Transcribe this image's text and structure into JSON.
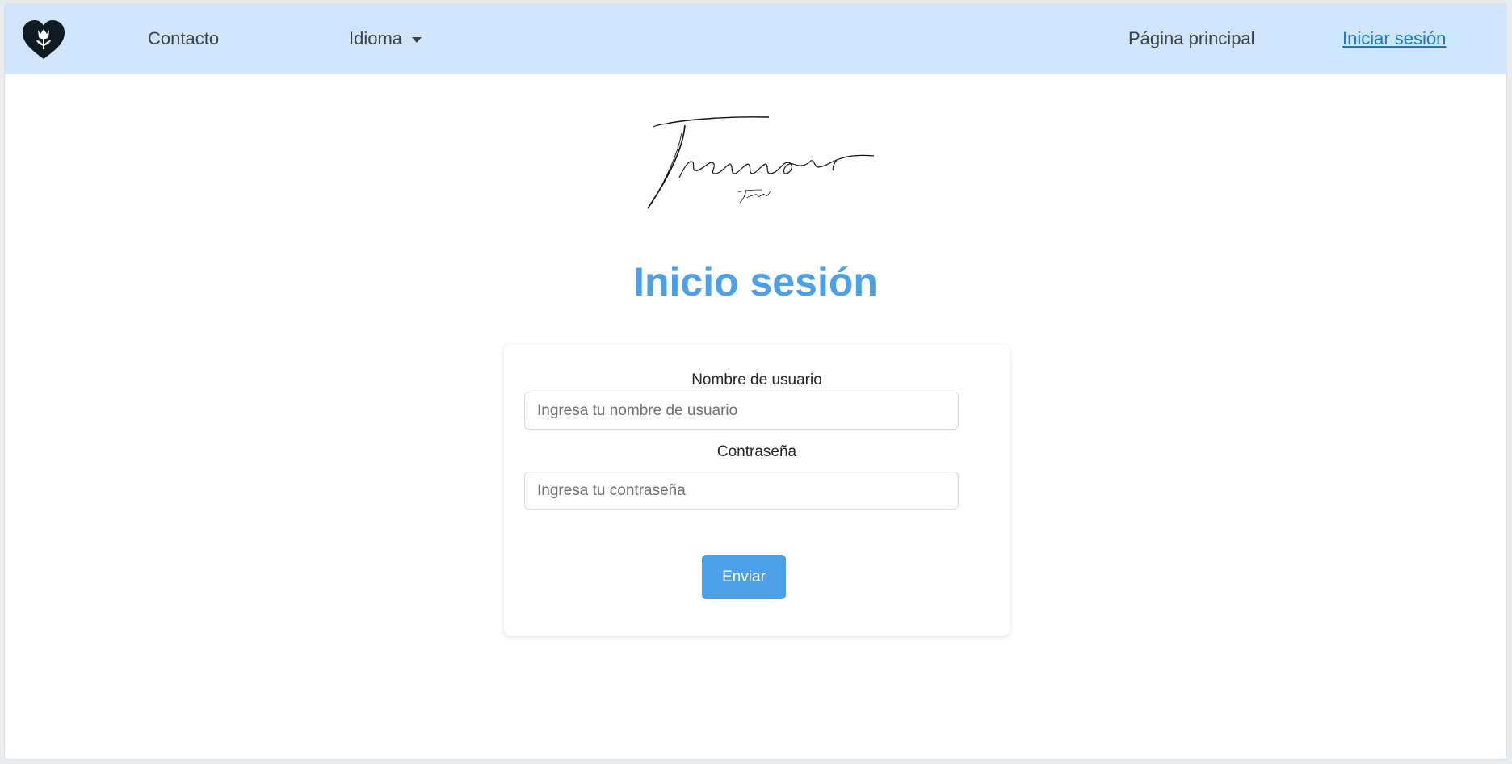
{
  "navbar": {
    "logo_icon": "heart-tulip-logo-icon",
    "contact_label": "Contacto",
    "language_label": "Idioma",
    "home_label": "Página principal",
    "login_label": "Iniciar sesión"
  },
  "brand": {
    "logo_text": "Tremor",
    "logo_subtext": "Track"
  },
  "page": {
    "title": "Inicio sesión"
  },
  "form": {
    "username_label": "Nombre de usuario",
    "username_placeholder": "Ingresa tu nombre de usuario",
    "username_value": "",
    "password_label": "Contraseña",
    "password_placeholder": "Ingresa tu contraseña",
    "password_value": "",
    "submit_label": "Enviar"
  },
  "colors": {
    "navbar_bg": "#cfe5fb",
    "accent": "#4ba0e8",
    "link_active": "#1976d2"
  }
}
